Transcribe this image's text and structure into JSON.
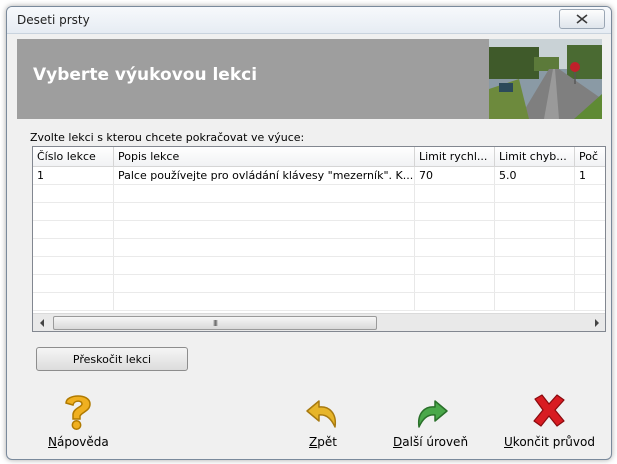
{
  "window": {
    "title": "Deseti prsty"
  },
  "header": {
    "title": "Vyberte výukovou lekci"
  },
  "prompt": "Zvolte lekci s kterou chcete pokračovat ve výuce:",
  "table": {
    "columns": [
      "Číslo lekce",
      "Popis lekce",
      "Limit rychl...",
      "Limit chyb...",
      "Poč"
    ],
    "rows": [
      [
        "1",
        "Palce používejte pro ovládání klávesy \"mezerník\". K...",
        "70",
        "5.0",
        "1"
      ]
    ]
  },
  "scrollbar": {
    "thumb_grip": "III"
  },
  "skip_button": "Přeskočit lekci",
  "actions": {
    "help": {
      "label_first": "N",
      "label_rest": "ápověda",
      "icon": "question-icon"
    },
    "back": {
      "label_first": "Z",
      "label_rest": "pět",
      "icon": "back-arrow-icon"
    },
    "next": {
      "label_first": "D",
      "label_rest": "alší úroveň",
      "icon": "forward-arrow-icon"
    },
    "exit": {
      "label_first": "U",
      "label_rest": "končit průvod",
      "icon": "red-x-icon"
    }
  },
  "colors": {
    "header_bg": "#9e9e9e",
    "next_green": "#3d9a3d",
    "exit_red": "#d0141a",
    "back_gold": "#e0a81e"
  }
}
